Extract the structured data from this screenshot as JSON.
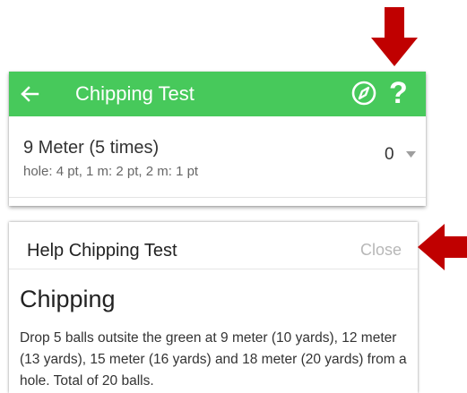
{
  "app_bar": {
    "title": "Chipping Test",
    "back_icon": "arrow-left-icon",
    "compass_icon": "compass-icon",
    "help_label": "?",
    "color": "#47c95b"
  },
  "test_item": {
    "title": "9 Meter (5 times)",
    "subtitle": "hole: 4 pt, 1 m: 2 pt, 2 m: 1 pt",
    "score_value": "0",
    "dropdown_icon": "caret-down-icon"
  },
  "help_dialog": {
    "title": "Help Chipping Test",
    "close_label": "Close",
    "heading": "Chipping",
    "body": "Drop 5 balls outsite the green at 9 meter (10 yards), 12 meter (13 yards), 15 meter (16 yards) and 18 meter (20 yards) from a hole. Total of 20 balls."
  },
  "annotations": {
    "arrow_color": "#c00000"
  }
}
